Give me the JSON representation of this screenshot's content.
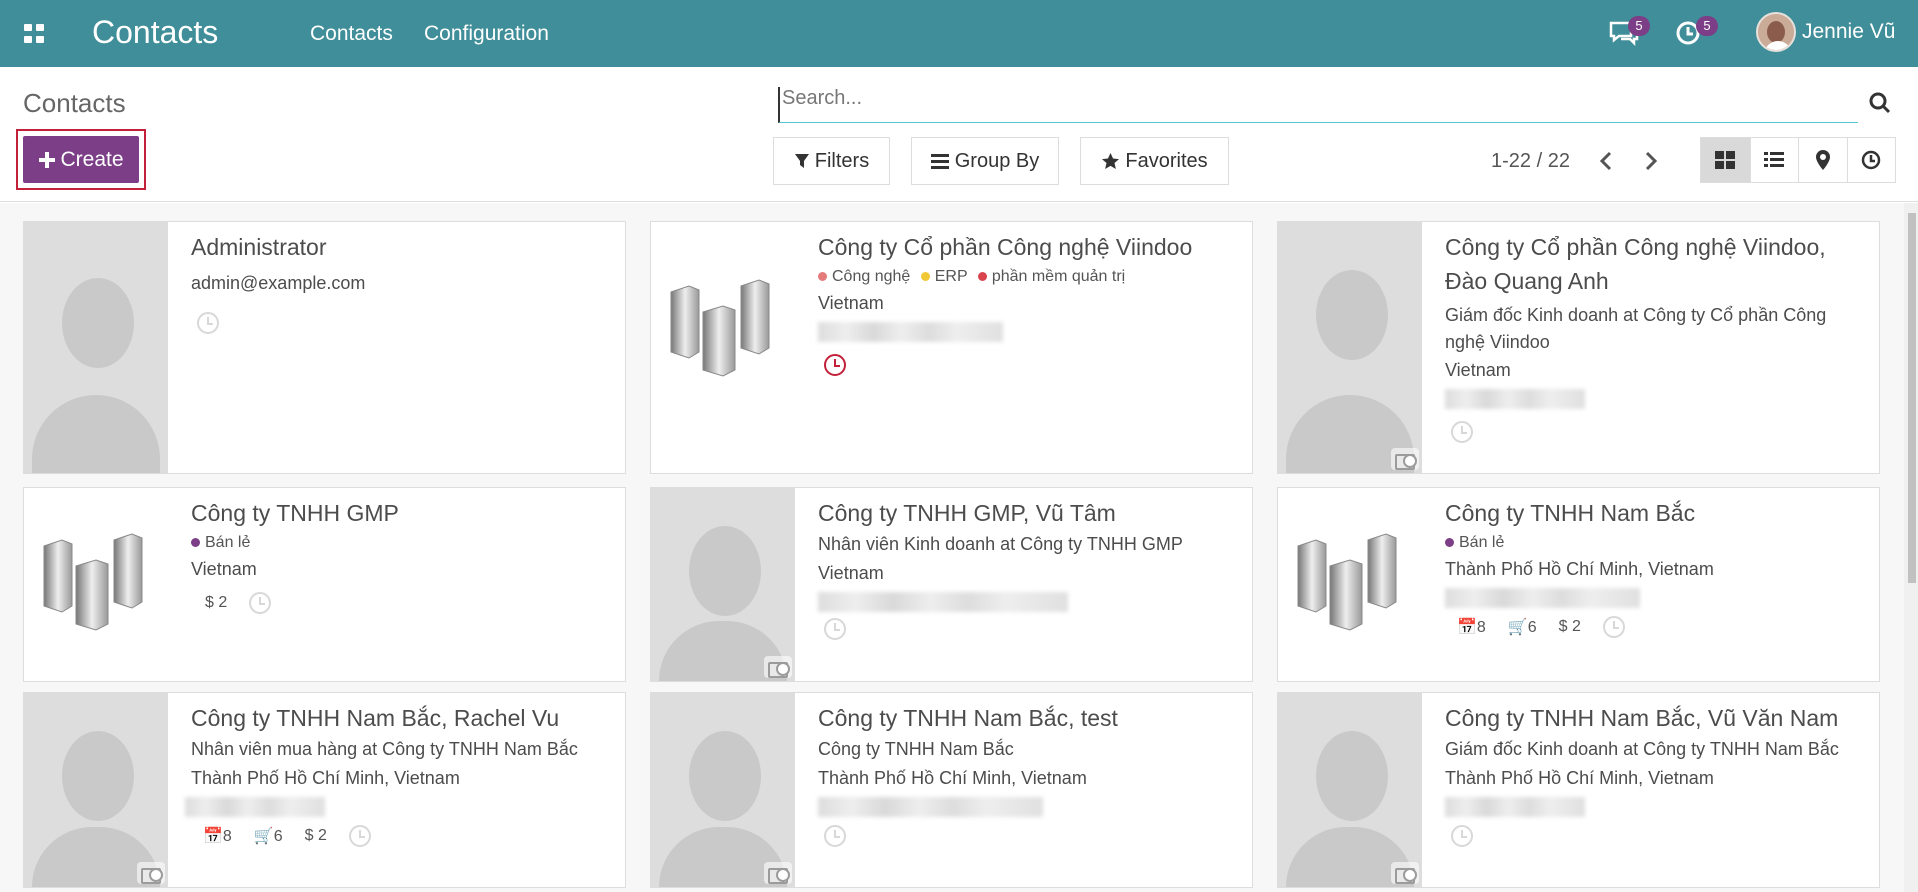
{
  "navbar": {
    "app_title": "Contacts",
    "menu": [
      "Contacts",
      "Configuration"
    ],
    "messages_count": "5",
    "activities_count": "5",
    "user_name": "Jennie Vũ",
    "color": "#3f8e99"
  },
  "control_panel": {
    "breadcrumb": "Contacts",
    "create_label": "Create",
    "search_placeholder": "Search...",
    "filters_label": "Filters",
    "group_by_label": "Group By",
    "favorites_label": "Favorites",
    "pager": "1-22 / 22",
    "view_icons": [
      "kanban-view-icon",
      "list-view-icon",
      "map-view-icon",
      "activity-view-icon"
    ]
  },
  "cards": [
    {
      "name": "Administrator",
      "email": "admin@example.com"
    },
    {
      "name": "Công ty Cổ phần Công nghệ Viindoo",
      "tags": [
        "Công nghệ",
        "ERP",
        "phần mềm quản trị"
      ],
      "country": "Vietnam"
    },
    {
      "name": "Công ty Cổ phần Công nghệ Viindoo, Đào Quang Anh",
      "job": "Giám đốc Kinh doanh at Công ty Cổ phần Công nghệ Viindoo",
      "country": "Vietnam"
    },
    {
      "name": "Công ty TNHH GMP",
      "tags": [
        "Bán lẻ"
      ],
      "country": "Vietnam",
      "sales": "2"
    },
    {
      "name": "Công ty TNHH GMP, Vũ Tâm",
      "job": "Nhân viên Kinh doanh at Công ty TNHH GMP",
      "country": "Vietnam"
    },
    {
      "name": "Công ty TNHH Nam Bắc",
      "tags": [
        "Bán lẻ"
      ],
      "country": "Thành Phố Hồ Chí Minh, Vietnam",
      "meetings": "8",
      "orders": "6",
      "sales": "2"
    },
    {
      "name": "Công ty TNHH Nam Bắc, Rachel Vu",
      "job": "Nhân viên mua hàng at Công ty TNHH Nam Bắc",
      "country": "Thành Phố Hồ Chí Minh, Vietnam",
      "meetings": "8",
      "orders": "6",
      "sales": "2"
    },
    {
      "name": "Công ty TNHH Nam Bắc, test",
      "job": "Công ty TNHH Nam Bắc",
      "country": "Thành Phố Hồ Chí Minh, Vietnam"
    },
    {
      "name": "Công ty TNHH Nam Bắc, Vũ Văn Nam",
      "job": "Giám đốc Kinh doanh at Công ty TNHH Nam Bắc",
      "country": "Thành Phố Hồ Chí Minh, Vietnam"
    }
  ],
  "tag_colors": [
    "#e47a7a",
    "#f2c735",
    "#d9434e",
    "#7c3f87"
  ]
}
